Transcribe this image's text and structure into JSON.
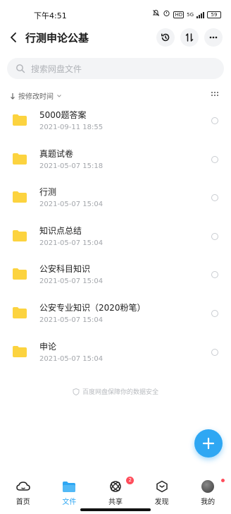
{
  "status_bar": {
    "time": "下午4:51",
    "icons": [
      "mute-bell-icon",
      "alarm-icon",
      "hd-icon",
      "5g-signal-icon"
    ],
    "hd": "HD",
    "network": "5G",
    "battery": "59"
  },
  "header": {
    "title": "行测申论公基",
    "back_icon": "chevron-left-icon",
    "actions": [
      "history-icon",
      "sort-icon",
      "more-icon"
    ]
  },
  "search": {
    "placeholder": "搜索网盘文件"
  },
  "sort": {
    "label": "按修改时间"
  },
  "files": [
    {
      "name": "5000题答案",
      "date": "2021-09-11  18:55"
    },
    {
      "name": "真题试卷",
      "date": "2021-05-07  15:18"
    },
    {
      "name": "行测",
      "date": "2021-05-07  15:04"
    },
    {
      "name": "知识点总结",
      "date": "2021-05-07  15:04"
    },
    {
      "name": "公安科目知识",
      "date": "2021-05-07  15:04"
    },
    {
      "name": "公安专业知识（2020粉笔）",
      "date": "2021-05-07  15:04"
    },
    {
      "name": "申论",
      "date": "2021-05-07  15:04"
    }
  ],
  "footer_note": "百度网盘保障你的数据安全",
  "tabs": [
    {
      "label": "首页",
      "icon": "cloud-icon"
    },
    {
      "label": "文件",
      "icon": "folder-icon"
    },
    {
      "label": "共享",
      "icon": "share-icon",
      "badge": "2"
    },
    {
      "label": "发现",
      "icon": "discover-icon"
    },
    {
      "label": "我的",
      "icon": "avatar-icon"
    }
  ],
  "colors": {
    "accent": "#2fa7f3",
    "folder": "#fcd33f",
    "badge": "#ff4d5b"
  }
}
